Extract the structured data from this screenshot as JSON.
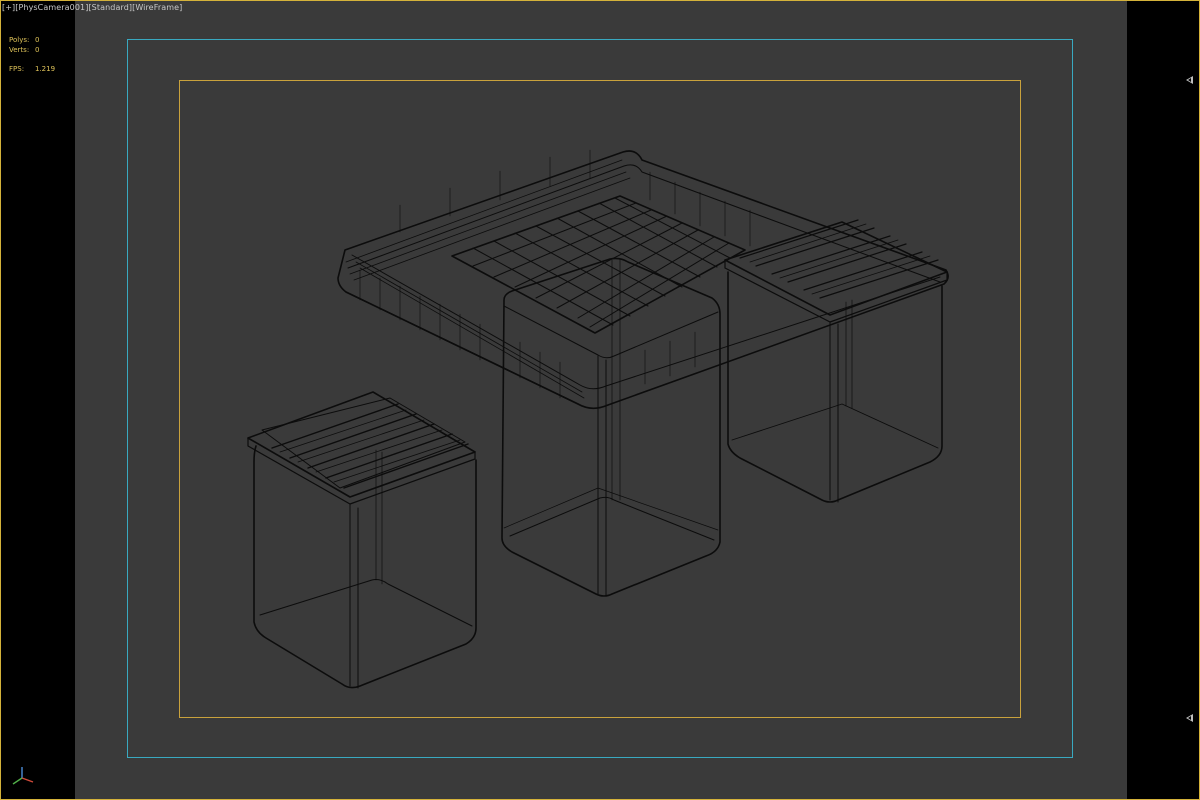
{
  "viewport": {
    "label_prefix": "[+]",
    "camera": "[PhysCamera001]",
    "shading_mode": "[Standard]",
    "display_mode": "[WireFrame]"
  },
  "stats": {
    "polys_label": "Polys:",
    "polys_value": "0",
    "verts_label": "Verts:",
    "verts_value": "0",
    "fps_label": "FPS:",
    "fps_value": "1.219"
  },
  "colors": {
    "viewport_bg": "#3a3a3a",
    "active_border": "#d4b23a",
    "safe_action_frame": "#39a9c0",
    "safe_title_frame": "#c9a23c",
    "wireframe": "#0c0c0c",
    "stats_text": "#e0c45a"
  },
  "icons": [
    "expand-right-arrow-icon",
    "expand-right-arrow-icon",
    "axis-tripod-icon"
  ]
}
